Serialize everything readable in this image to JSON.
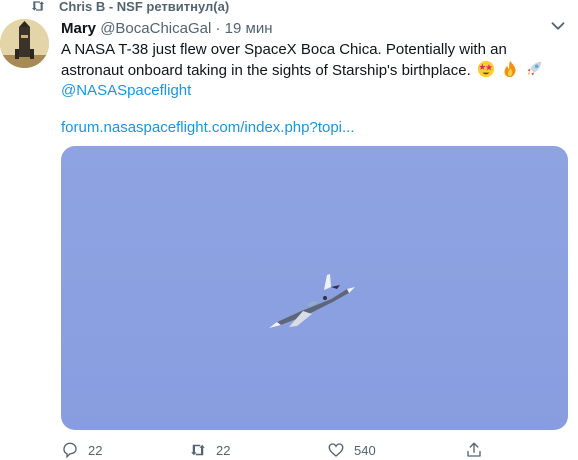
{
  "retweet_banner": {
    "text": "Chris B - NSF ретвитнул(а)"
  },
  "tweet": {
    "author_name": "Mary",
    "author_handle": "@BocaChicaGal",
    "separator": "·",
    "time": "19 мин",
    "text_line1": "A NASA T-38 just flew over SpaceX Boca Chica. Potentially with an astronaut onboard taking in the sights of Starship's birthplace.",
    "emojis": [
      "star-struck-face-icon",
      "fire-icon",
      "rocket-icon"
    ],
    "mention": "@NASASpaceflight",
    "url": "forum.nasaspaceflight.com/index.php?topi...",
    "media_alt": "T-38 jet flying in blue sky"
  },
  "actions": {
    "reply_count": "22",
    "retweet_count": "22",
    "like_count": "540"
  },
  "colors": {
    "link": "#1b95e0",
    "muted": "#536471",
    "sky": "#8aa0e0"
  }
}
